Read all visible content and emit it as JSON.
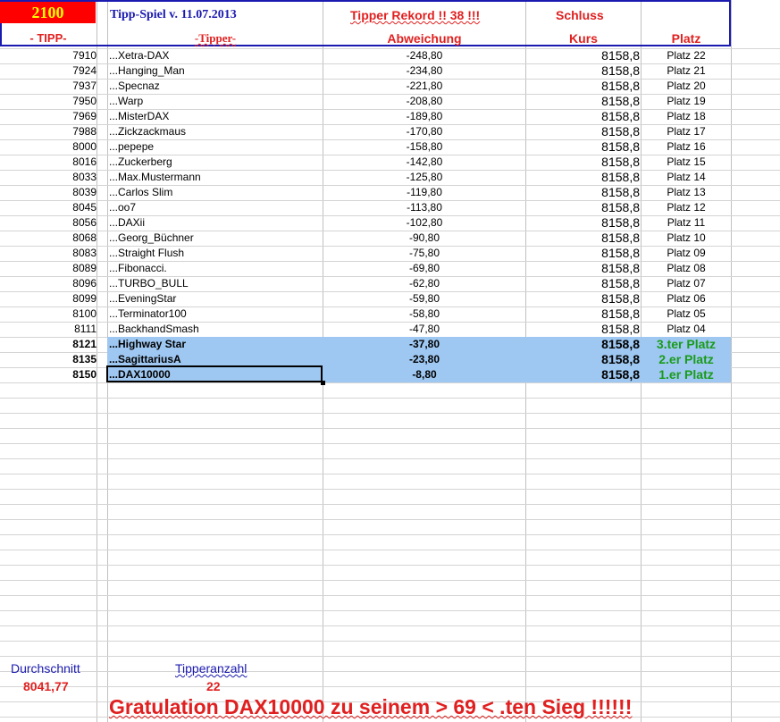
{
  "header": {
    "points": "2100",
    "title": "Tipp-Spiel v. 11.07.2013",
    "rekord": "Tipper Rekord !!  38  !!!",
    "schluss": "Schluss",
    "col_tipp": "- TIPP-",
    "col_tipper": "-Tipper-",
    "col_abweichung": "Abweichung",
    "col_kurs": "Kurs",
    "col_platz": "Platz"
  },
  "rows": [
    {
      "tipp": "7910",
      "name": "...Xetra-DAX",
      "abw": "-248,80",
      "kurs": "8158,8",
      "platz": "Platz 22"
    },
    {
      "tipp": "7924",
      "name": "...Hanging_Man",
      "abw": "-234,80",
      "kurs": "8158,8",
      "platz": "Platz 21"
    },
    {
      "tipp": "7937",
      "name": "...Specnaz",
      "abw": "-221,80",
      "kurs": "8158,8",
      "platz": "Platz 20"
    },
    {
      "tipp": "7950",
      "name": "...Warp",
      "abw": "-208,80",
      "kurs": "8158,8",
      "platz": "Platz 19"
    },
    {
      "tipp": "7969",
      "name": "...MisterDAX",
      "abw": "-189,80",
      "kurs": "8158,8",
      "platz": "Platz 18"
    },
    {
      "tipp": "7988",
      "name": "...Zickzackmaus",
      "abw": "-170,80",
      "kurs": "8158,8",
      "platz": "Platz 17"
    },
    {
      "tipp": "8000",
      "name": "...pepepe",
      "abw": "-158,80",
      "kurs": "8158,8",
      "platz": "Platz 16"
    },
    {
      "tipp": "8016",
      "name": "...Zuckerberg",
      "abw": "-142,80",
      "kurs": "8158,8",
      "platz": "Platz 15"
    },
    {
      "tipp": "8033",
      "name": "...Max.Mustermann",
      "abw": "-125,80",
      "kurs": "8158,8",
      "platz": "Platz 14"
    },
    {
      "tipp": "8039",
      "name": "...Carlos Slim",
      "abw": "-119,80",
      "kurs": "8158,8",
      "platz": "Platz 13"
    },
    {
      "tipp": "8045",
      "name": "...oo7",
      "abw": "-113,80",
      "kurs": "8158,8",
      "platz": "Platz 12"
    },
    {
      "tipp": "8056",
      "name": "...DAXii",
      "abw": "-102,80",
      "kurs": "8158,8",
      "platz": "Platz 11"
    },
    {
      "tipp": "8068",
      "name": "...Georg_Büchner",
      "abw": "-90,80",
      "kurs": "8158,8",
      "platz": "Platz 10"
    },
    {
      "tipp": "8083",
      "name": "...Straight Flush",
      "abw": "-75,80",
      "kurs": "8158,8",
      "platz": "Platz 09"
    },
    {
      "tipp": "8089",
      "name": "...Fibonacci.",
      "abw": "-69,80",
      "kurs": "8158,8",
      "platz": "Platz 08"
    },
    {
      "tipp": "8096",
      "name": "...TURBO_BULL",
      "abw": "-62,80",
      "kurs": "8158,8",
      "platz": "Platz 07"
    },
    {
      "tipp": "8099",
      "name": "...EveningStar",
      "abw": "-59,80",
      "kurs": "8158,8",
      "platz": "Platz 06"
    },
    {
      "tipp": "8100",
      "name": "...Terminator100",
      "abw": "-58,80",
      "kurs": "8158,8",
      "platz": "Platz 05"
    },
    {
      "tipp": "8111",
      "name": "...BackhandSmash",
      "abw": "-47,80",
      "kurs": "8158,8",
      "platz": "Platz 04"
    },
    {
      "tipp": "8121",
      "name": "...Highway Star",
      "abw": "-37,80",
      "kurs": "8158,8",
      "platz": "3.ter Platz"
    },
    {
      "tipp": "8135",
      "name": "...SagittariusA",
      "abw": "-23,80",
      "kurs": "8158,8",
      "platz": "2.er Platz"
    },
    {
      "tipp": "8150",
      "name": "...DAX10000",
      "abw": "-8,80",
      "kurs": "8158,8",
      "platz": "1.er Platz"
    }
  ],
  "footer": {
    "durchschnitt_label": "Durchschnitt",
    "durchschnitt_value": "8041,77",
    "tipperanzahl_label": "Tipperanzahl",
    "tipperanzahl_value": "22",
    "gratulation": "Gratulation DAX10000  zu seinem > 69 < .ten Sieg !!!!!!"
  },
  "colors": {
    "header_red": "#ff0000",
    "title_blue": "#1a1ab0",
    "highlight": "#9ec7f1",
    "winner_green": "#1a9b1a"
  }
}
